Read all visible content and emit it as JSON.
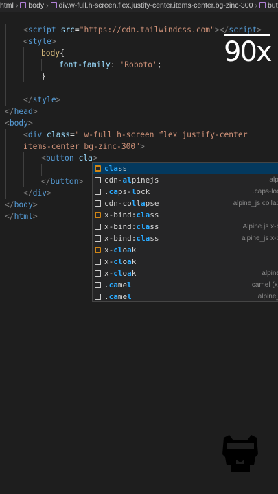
{
  "breadcrumb": {
    "items": [
      "html",
      "body",
      "div.w-full.h-screen.flex.justify-center.items-center.bg-zinc-300",
      "butto"
    ]
  },
  "editor": {
    "lines": [
      [
        [
          "t-br",
          "<"
        ],
        [
          "t-tag",
          "script"
        ],
        [
          "t-txt",
          " "
        ],
        [
          "t-attr",
          "src"
        ],
        [
          "t-txt",
          "="
        ],
        [
          "t-str",
          "\"https://cdn.tailwindcss.com\""
        ],
        [
          "t-br",
          "></"
        ],
        [
          "t-tag",
          "script"
        ],
        [
          "t-br",
          ">"
        ]
      ],
      [
        [
          "t-br",
          "<"
        ],
        [
          "t-tag",
          "style"
        ],
        [
          "t-br",
          ">"
        ]
      ],
      [
        [
          "t-sel",
          "body"
        ],
        [
          "t-txt",
          "{"
        ]
      ],
      [
        [
          "t-prop",
          "font-family"
        ],
        [
          "t-txt",
          ": "
        ],
        [
          "t-str",
          "'Roboto'"
        ],
        [
          "t-txt",
          ";"
        ]
      ],
      [
        [
          "t-txt",
          "}"
        ]
      ],
      [],
      [
        [
          "t-br",
          "</"
        ],
        [
          "t-tag",
          "style"
        ],
        [
          "t-br",
          ">"
        ]
      ],
      [
        [
          "t-br",
          "</"
        ],
        [
          "t-tag",
          "head"
        ],
        [
          "t-br",
          ">"
        ]
      ],
      [
        [
          "t-br",
          "<"
        ],
        [
          "t-tag",
          "body"
        ],
        [
          "t-br",
          ">"
        ]
      ],
      [
        [
          "t-br",
          "<"
        ],
        [
          "t-tag",
          "div"
        ],
        [
          "t-txt",
          " "
        ],
        [
          "t-attr",
          "class"
        ],
        [
          "t-txt",
          "="
        ],
        [
          "t-str",
          "\" w-full h-screen flex justify-center"
        ]
      ],
      [
        [
          "t-str",
          "items-center bg-zinc-300\""
        ],
        [
          "t-br",
          ">"
        ]
      ],
      [
        [
          "t-br",
          "<"
        ],
        [
          "t-tag",
          "button"
        ],
        [
          "t-txt",
          " "
        ],
        [
          "t-attr",
          "cla"
        ],
        [
          "cursor",
          ""
        ],
        [
          "t-br",
          ">"
        ]
      ],
      [],
      [
        [
          "t-br",
          "</"
        ],
        [
          "t-tag",
          "button"
        ],
        [
          "t-br",
          ">"
        ]
      ],
      [
        [
          "t-br",
          "</"
        ],
        [
          "t-tag",
          "div"
        ],
        [
          "t-br",
          ">"
        ]
      ],
      [
        [
          "t-br",
          "</"
        ],
        [
          "t-tag",
          "body"
        ],
        [
          "t-br",
          ">"
        ]
      ],
      [
        [
          "t-br",
          "</"
        ],
        [
          "t-tag",
          "html"
        ],
        [
          "t-br",
          ">"
        ]
      ]
    ]
  },
  "suggestions": [
    {
      "icon": "snippet-orange",
      "parts": [
        [
          "b",
          "cla"
        ],
        [
          "",
          "ss"
        ]
      ],
      "detail": ""
    },
    {
      "icon": "keyword",
      "parts": [
        [
          "",
          "cdn-"
        ],
        [
          "b",
          "al"
        ],
        [
          "",
          "pinejs"
        ]
      ],
      "detail": "alpi"
    },
    {
      "icon": "keyword",
      "parts": [
        [
          "",
          "."
        ],
        [
          "b",
          "ca"
        ],
        [
          "",
          "ps-"
        ],
        [
          "b",
          "l"
        ],
        [
          "",
          "ock"
        ]
      ],
      "detail": ".caps-loc"
    },
    {
      "icon": "keyword",
      "parts": [
        [
          "",
          "cdn-co"
        ],
        [
          "b",
          "l"
        ],
        [
          "",
          "l"
        ],
        [
          "b",
          "a"
        ],
        [
          "",
          "pse"
        ]
      ],
      "detail": "alpine_js collap"
    },
    {
      "icon": "snippet-orange",
      "parts": [
        [
          "",
          "x-bind:"
        ],
        [
          "b",
          "cla"
        ],
        [
          "",
          "ss"
        ]
      ],
      "detail": ""
    },
    {
      "icon": "keyword",
      "parts": [
        [
          "",
          "x-bind:"
        ],
        [
          "b",
          "cla"
        ],
        [
          "",
          "ss"
        ]
      ],
      "detail": "Alpine.js x-b"
    },
    {
      "icon": "keyword",
      "parts": [
        [
          "",
          "x-bind:"
        ],
        [
          "b",
          "cla"
        ],
        [
          "",
          "ss"
        ]
      ],
      "detail": "alpine_js x-b"
    },
    {
      "icon": "snippet-orange",
      "parts": [
        [
          "",
          "x-"
        ],
        [
          "b",
          "cl"
        ],
        [
          "",
          "o"
        ],
        [
          "b",
          "a"
        ],
        [
          "",
          "k"
        ]
      ],
      "detail": ""
    },
    {
      "icon": "keyword",
      "parts": [
        [
          "",
          "x-"
        ],
        [
          "b",
          "cl"
        ],
        [
          "",
          "o"
        ],
        [
          "b",
          "a"
        ],
        [
          "",
          "k"
        ]
      ],
      "detail": ""
    },
    {
      "icon": "keyword",
      "parts": [
        [
          "",
          "x-"
        ],
        [
          "b",
          "cl"
        ],
        [
          "",
          "o"
        ],
        [
          "b",
          "a"
        ],
        [
          "",
          "k"
        ]
      ],
      "detail": "alpine"
    },
    {
      "icon": "keyword",
      "parts": [
        [
          "",
          "."
        ],
        [
          "b",
          "ca"
        ],
        [
          "",
          "me"
        ],
        [
          "b",
          "l"
        ]
      ],
      "detail": ".camel (x-"
    },
    {
      "icon": "keyword",
      "parts": [
        [
          "",
          "."
        ],
        [
          "b",
          "ca"
        ],
        [
          "",
          "me"
        ],
        [
          "b",
          "l"
        ]
      ],
      "detail": "alpine_"
    }
  ],
  "speed_badge": "90x",
  "colors": {
    "background": "#1e1e1e",
    "match_highlight": "#2aaaff",
    "snippet_icon": "#d18616"
  }
}
